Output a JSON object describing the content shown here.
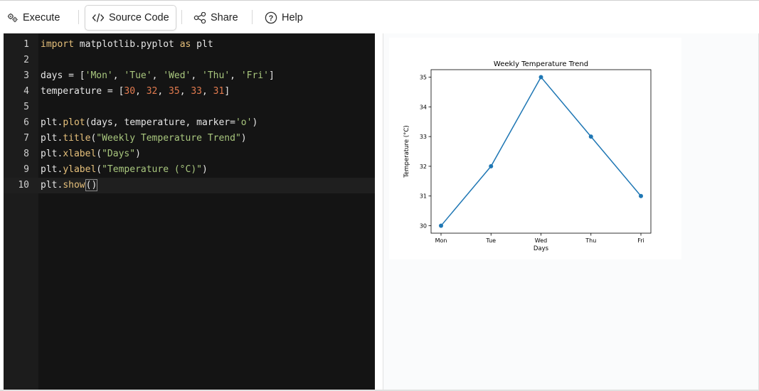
{
  "toolbar": {
    "execute_label": "Execute",
    "source_code_label": "Source Code",
    "share_label": "Share",
    "help_label": "Help"
  },
  "editor": {
    "lines": [
      {
        "n": "1",
        "tokens": [
          [
            "kw",
            "import"
          ],
          [
            "pl",
            " matplotlib.pyplot "
          ],
          [
            "kw",
            "as"
          ],
          [
            "pl",
            " plt"
          ]
        ]
      },
      {
        "n": "2",
        "tokens": []
      },
      {
        "n": "3",
        "tokens": [
          [
            "pl",
            "days = ["
          ],
          [
            "str",
            "'Mon'"
          ],
          [
            "pl",
            ", "
          ],
          [
            "str",
            "'Tue'"
          ],
          [
            "pl",
            ", "
          ],
          [
            "str",
            "'Wed'"
          ],
          [
            "pl",
            ", "
          ],
          [
            "str",
            "'Thu'"
          ],
          [
            "pl",
            ", "
          ],
          [
            "str",
            "'Fri'"
          ],
          [
            "pl",
            "]"
          ]
        ]
      },
      {
        "n": "4",
        "tokens": [
          [
            "pl",
            "temperature = ["
          ],
          [
            "num",
            "30"
          ],
          [
            "pl",
            ", "
          ],
          [
            "num",
            "32"
          ],
          [
            "pl",
            ", "
          ],
          [
            "num",
            "35"
          ],
          [
            "pl",
            ", "
          ],
          [
            "num",
            "33"
          ],
          [
            "pl",
            ", "
          ],
          [
            "num",
            "31"
          ],
          [
            "pl",
            "]"
          ]
        ]
      },
      {
        "n": "5",
        "tokens": []
      },
      {
        "n": "6",
        "tokens": [
          [
            "pl",
            "plt."
          ],
          [
            "fn",
            "plot"
          ],
          [
            "pl",
            "(days, temperature, marker="
          ],
          [
            "str",
            "'o'"
          ],
          [
            "pl",
            ")"
          ]
        ]
      },
      {
        "n": "7",
        "tokens": [
          [
            "pl",
            "plt."
          ],
          [
            "fn",
            "title"
          ],
          [
            "pl",
            "("
          ],
          [
            "str",
            "\"Weekly Temperature Trend\""
          ],
          [
            "pl",
            ")"
          ]
        ]
      },
      {
        "n": "8",
        "tokens": [
          [
            "pl",
            "plt."
          ],
          [
            "fn",
            "xlabel"
          ],
          [
            "pl",
            "("
          ],
          [
            "str",
            "\"Days\""
          ],
          [
            "pl",
            ")"
          ]
        ]
      },
      {
        "n": "9",
        "tokens": [
          [
            "pl",
            "plt."
          ],
          [
            "fn",
            "ylabel"
          ],
          [
            "pl",
            "("
          ],
          [
            "str",
            "\"Temperature (°C)\""
          ],
          [
            "pl",
            ")"
          ]
        ]
      },
      {
        "n": "10",
        "tokens": [
          [
            "pl",
            "plt."
          ],
          [
            "fn",
            "show"
          ],
          [
            "cur",
            "()"
          ]
        ]
      }
    ],
    "current_line": 10
  },
  "chart_data": {
    "type": "line",
    "title": "Weekly Temperature Trend",
    "xlabel": "Days",
    "ylabel": "Temperature (°C)",
    "categories": [
      "Mon",
      "Tue",
      "Wed",
      "Thu",
      "Fri"
    ],
    "values": [
      30,
      32,
      35,
      33,
      31
    ],
    "yticks": [
      30,
      31,
      32,
      33,
      34,
      35
    ],
    "ylim": [
      29.75,
      35.25
    ],
    "marker": "o",
    "color": "#1f77b4",
    "grid": false
  }
}
